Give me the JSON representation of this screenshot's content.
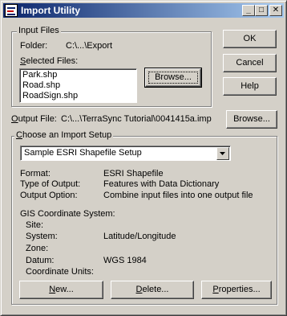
{
  "window": {
    "title": "Import Utility",
    "minimize_glyph": "_",
    "maximize_glyph": "□",
    "close_glyph": "✕"
  },
  "input_files": {
    "group_label": "Input Files",
    "folder_label": "Folder:",
    "folder_value": "C:\\...\\Export",
    "selected_label": "Selected Files:",
    "files": [
      "Park.shp",
      "Road.shp",
      "RoadSign.shp"
    ],
    "browse_label": "Browse..."
  },
  "output_file": {
    "label": "Output File:",
    "value": "C:\\...\\TerraSync Tutorial\\0041415a.imp",
    "browse_label": "Browse..."
  },
  "buttons": {
    "ok": "OK",
    "cancel": "Cancel",
    "help": "Help"
  },
  "import_setup": {
    "group_label": "Choose an Import Setup",
    "selected_setup": "Sample ESRI Shapefile Setup",
    "format_label": "Format:",
    "format_value": "ESRI Shapefile",
    "type_label": "Type of Output:",
    "type_value": "Features with Data Dictionary",
    "option_label": "Output Option:",
    "option_value": "Combine input files into one output file",
    "gis_label": "GIS Coordinate System:",
    "site_label": "Site:",
    "site_value": "",
    "system_label": "System:",
    "system_value": "Latitude/Longitude",
    "zone_label": "Zone:",
    "zone_value": "",
    "datum_label": "Datum:",
    "datum_value": "WGS 1984",
    "units_label": "Coordinate Units:",
    "units_value": "",
    "new_label": "New...",
    "delete_label": "Delete...",
    "properties_label": "Properties..."
  }
}
